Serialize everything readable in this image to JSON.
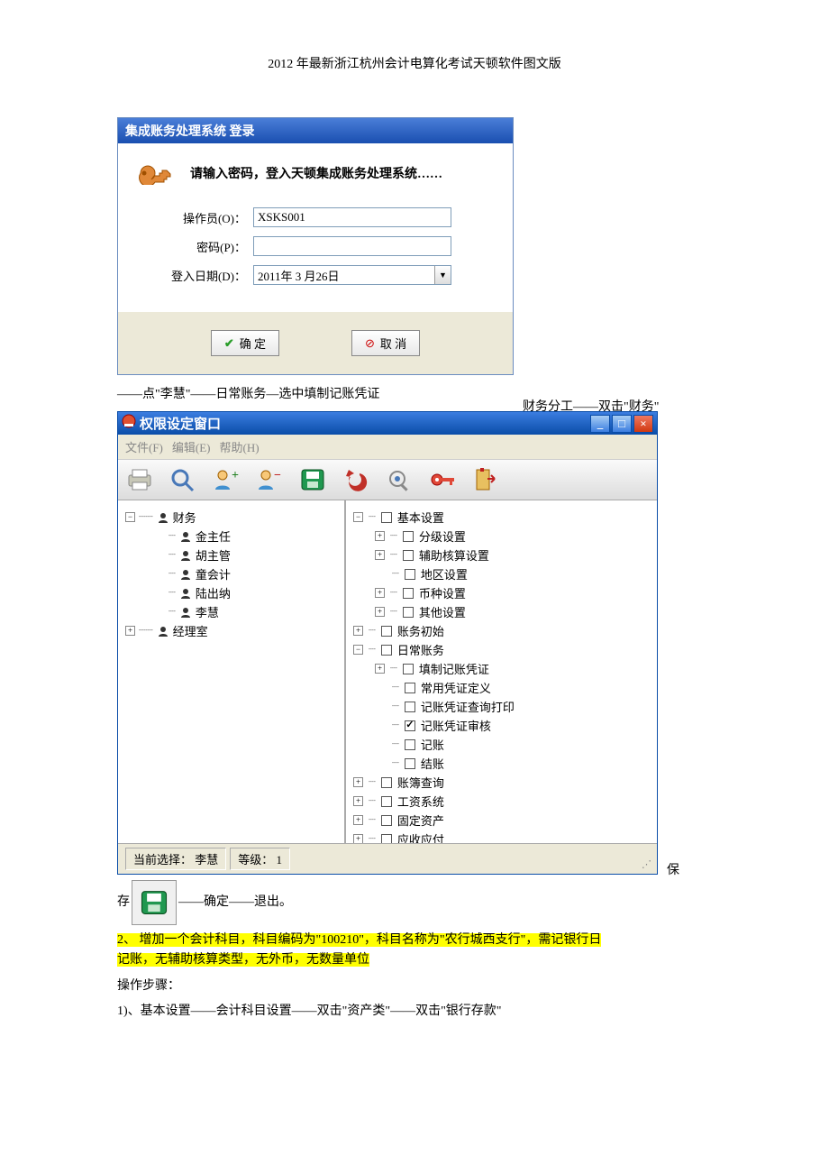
{
  "doc_title": "2012 年最新浙江杭州会计电算化考试天顿软件图文版",
  "login": {
    "title": "集成账务处理系统 登录",
    "prompt": "请输入密码，登入天顿集成账务处理系统……",
    "operator_label": "操作员(O)：",
    "operator_value": "XSKS001",
    "password_label": "密码(P)：",
    "password_value": "",
    "date_label": "登入日期(D)：",
    "date_value": "2011年 3 月26日",
    "ok": "确 定",
    "cancel": "取 消"
  },
  "side_note": "财务分工——双击\"财务\"",
  "para1": "——点\"李慧\"——日常账务—选中填制记账凭证",
  "perm": {
    "title": "权限设定窗口",
    "menu": {
      "file": "文件(F)",
      "edit": "编辑(E)",
      "help": "帮助(H)"
    },
    "left_tree": {
      "root1": "财务",
      "people": [
        "金主任",
        "胡主管",
        "童会计",
        "陆出纳",
        "李慧"
      ],
      "root2": "经理室"
    },
    "right_tree": [
      {
        "pad": 0,
        "expander": "−",
        "chk": false,
        "label": "基本设置"
      },
      {
        "pad": 1,
        "expander": "+",
        "chk": false,
        "label": "分级设置"
      },
      {
        "pad": 1,
        "expander": "+",
        "chk": false,
        "label": "辅助核算设置"
      },
      {
        "pad": 1,
        "expander": "",
        "chk": false,
        "label": "地区设置"
      },
      {
        "pad": 1,
        "expander": "+",
        "chk": false,
        "label": "币种设置"
      },
      {
        "pad": 1,
        "expander": "+",
        "chk": false,
        "label": "其他设置"
      },
      {
        "pad": 0,
        "expander": "+",
        "chk": false,
        "label": "账务初始"
      },
      {
        "pad": 0,
        "expander": "−",
        "chk": false,
        "label": "日常账务"
      },
      {
        "pad": 1,
        "expander": "+",
        "chk": false,
        "label": "填制记账凭证"
      },
      {
        "pad": 1,
        "expander": "",
        "chk": false,
        "label": "常用凭证定义"
      },
      {
        "pad": 1,
        "expander": "",
        "chk": false,
        "label": "记账凭证查询打印"
      },
      {
        "pad": 1,
        "expander": "",
        "chk": true,
        "label": "记账凭证审核"
      },
      {
        "pad": 1,
        "expander": "",
        "chk": false,
        "label": "记账"
      },
      {
        "pad": 1,
        "expander": "",
        "chk": false,
        "label": "结账"
      },
      {
        "pad": 0,
        "expander": "+",
        "chk": false,
        "label": "账簿查询"
      },
      {
        "pad": 0,
        "expander": "+",
        "chk": false,
        "label": "工资系统"
      },
      {
        "pad": 0,
        "expander": "+",
        "chk": false,
        "label": "固定资产"
      },
      {
        "pad": 0,
        "expander": "+",
        "chk": false,
        "label": "应收应付"
      }
    ],
    "status": {
      "sel_label": "当前选择：",
      "sel_value": "李慧",
      "level_label": "等级：",
      "level_value": "1"
    }
  },
  "save_suffix_right": "保",
  "save_line_prefix": "存",
  "save_line_suffix": "——确定——退出。",
  "task2_line1": "2、 增加一个会计科目，科目编码为\"100210\"，科目名称为\"农行城西支行\"，需记银行日",
  "task2_line2": "记账，无辅助核算类型，无外币，无数量单位",
  "steps_label": "操作步骤：",
  "step1": "1)、基本设置——会计科目设置——双击\"资产类\"——双击\"银行存款\""
}
